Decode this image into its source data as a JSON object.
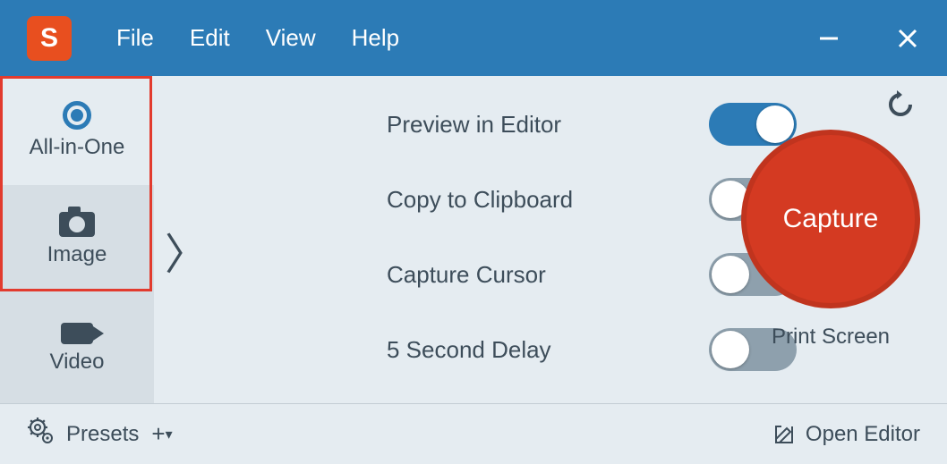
{
  "menu": {
    "file": "File",
    "edit": "Edit",
    "view": "View",
    "help": "Help"
  },
  "tabs": {
    "allinone": "All-in-One",
    "image": "Image",
    "video": "Video"
  },
  "options": {
    "preview": "Preview in Editor",
    "copy": "Copy to Clipboard",
    "cursor": "Capture Cursor",
    "delay": "5 Second Delay"
  },
  "capture": {
    "button": "Capture",
    "hotkey": "Print Screen"
  },
  "footer": {
    "presets": "Presets",
    "open_editor": "Open Editor"
  },
  "toggle_states": {
    "preview": true,
    "copy": false,
    "cursor": false,
    "delay": false
  }
}
